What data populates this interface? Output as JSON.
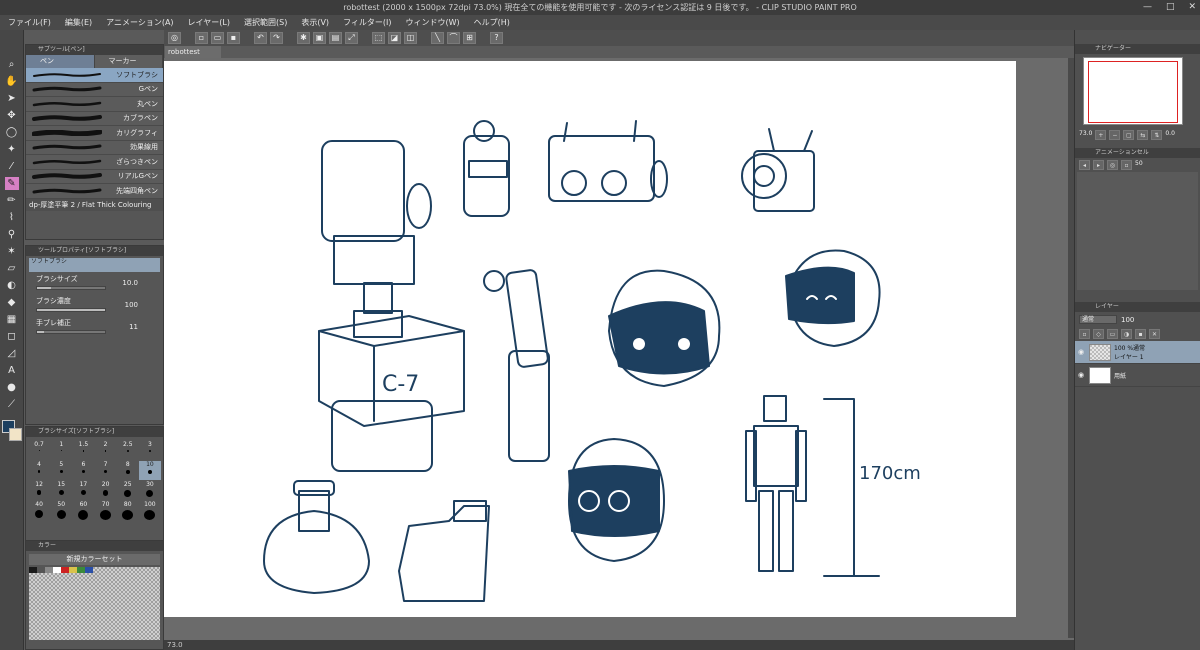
{
  "window": {
    "title": "robottest (2000 x 1500px 72dpi 73.0%)  現在全ての機能を使用可能です - 次のライセンス認証は 9 日後です。 - CLIP STUDIO PAINT PRO",
    "controls": [
      "—",
      "□",
      "✕"
    ]
  },
  "menu": [
    "ファイル(F)",
    "編集(E)",
    "アニメーション(A)",
    "レイヤー(L)",
    "選択範囲(S)",
    "表示(V)",
    "フィルター(I)",
    "ウィンドウ(W)",
    "ヘルプ(H)"
  ],
  "document": {
    "tab": "robottest",
    "zoom": "73.0"
  },
  "subtool_panel": {
    "header": "サブツール[ペン]",
    "tabs": [
      "ペン",
      "マーカー"
    ],
    "brushes": [
      "ソフトブラシ",
      "Gペン",
      "丸ペン",
      "カブラペン",
      "カリグラフィ",
      "効果線用",
      "ざらつきペン",
      "リアルGペン",
      "先端四角ペン"
    ],
    "footer": "dp-厚塗平筆 2 / Flat Thick Colouring"
  },
  "tool_property": {
    "header": "ツールプロパティ[ソフトブラシ]",
    "preview_label": "ソフトブラシ",
    "rows": [
      {
        "label": "ブラシサイズ",
        "value": "10.0",
        "fill": 0.2
      },
      {
        "label": "ブラシ濃度",
        "value": "100",
        "fill": 1.0
      },
      {
        "label": "手ブレ補正",
        "value": "11",
        "fill": 0.11
      }
    ]
  },
  "brush_size": {
    "header": "ブラシサイズ[ソフトブラシ]",
    "values": [
      "0.7",
      "1",
      "1.5",
      "2",
      "2.5",
      "3",
      "4",
      "5",
      "6",
      "7",
      "8",
      "10",
      "12",
      "15",
      "17",
      "20",
      "25",
      "30",
      "40",
      "50",
      "60",
      "70",
      "80",
      "100"
    ],
    "selected": "10"
  },
  "color_set": {
    "header": "カラー",
    "title": "新規カラーセット"
  },
  "navigator": {
    "header": "ナビゲーター",
    "zoom": "73.0",
    "rotation": "0.0"
  },
  "animation": {
    "header": "アニメーションセル",
    "value": "50",
    "cell_label": "描画1.[1]"
  },
  "layers": {
    "header": "レイヤー",
    "blend_mode": "通常",
    "opacity": "100",
    "items": [
      {
        "name": "100 %通常\nレイヤー 1",
        "active": true
      },
      {
        "name": "用紙",
        "active": false
      }
    ]
  },
  "colors": {
    "accent": "#8aa6c3",
    "pen_tool": "#d680c4",
    "ink": "#1d3f5f"
  }
}
